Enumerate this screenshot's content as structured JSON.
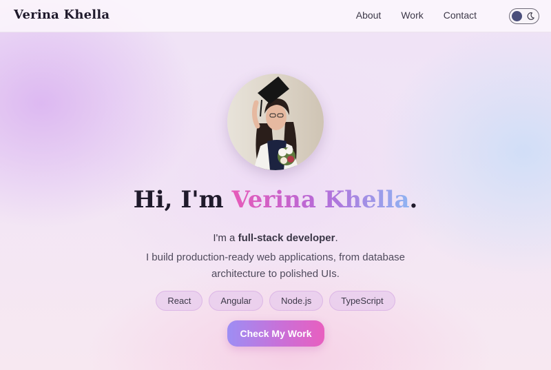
{
  "header": {
    "logo": "Verina Khella",
    "nav": [
      {
        "label": "About"
      },
      {
        "label": "Work"
      },
      {
        "label": "Contact"
      }
    ],
    "theme_toggle": {
      "mode": "light",
      "icon": "moon-icon"
    }
  },
  "hero": {
    "title_prefix": "Hi, I'm ",
    "title_name": "Verina Khella",
    "title_suffix": ".",
    "intro_prefix": "I'm a ",
    "intro_bold": "full-stack developer",
    "intro_suffix": ".",
    "description": "I build production-ready web applications, from database architecture to polished UIs.",
    "tags": [
      {
        "label": "React"
      },
      {
        "label": "Angular"
      },
      {
        "label": "Node.js"
      },
      {
        "label": "TypeScript"
      }
    ],
    "cta_label": "Check My Work"
  },
  "colors": {
    "name_gradient": [
      "#e75ab8",
      "#b56ad8",
      "#8fb4f2"
    ],
    "cta_gradient": [
      "#9d8ef4",
      "#c970d8",
      "#e85fbf"
    ],
    "toggle_knob": "#4a4e7a"
  }
}
